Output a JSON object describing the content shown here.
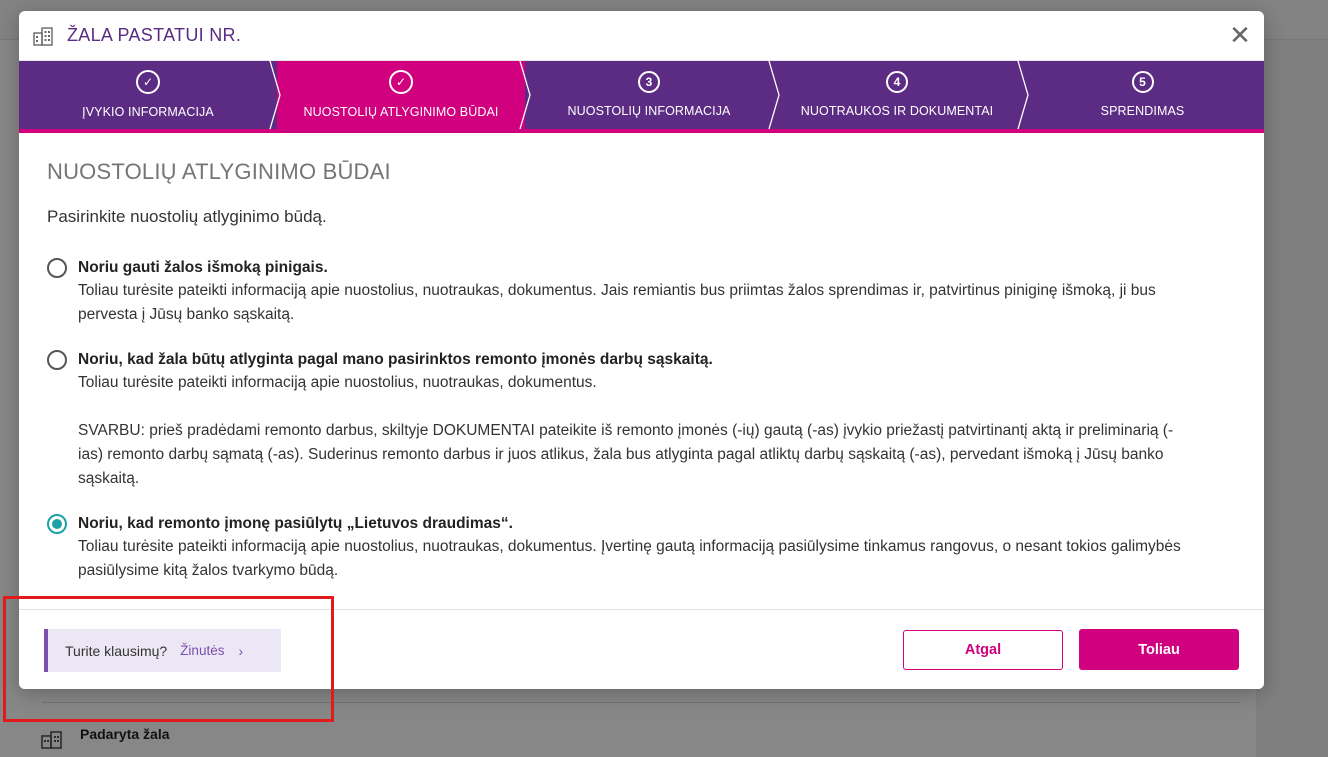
{
  "background": {
    "item_label": "Padaryta žala"
  },
  "modal": {
    "title": "ŽALA PASTATUI NR.",
    "close_glyph": "✕",
    "steps": [
      {
        "marker": "✓",
        "label": "ĮVYKIO INFORMACIJA",
        "state": "done"
      },
      {
        "marker": "✓",
        "label": "NUOSTOLIŲ ATLYGINIMO BŪDAI",
        "state": "active"
      },
      {
        "marker": "3",
        "label": "NUOSTOLIŲ INFORMACIJA",
        "state": "pending"
      },
      {
        "marker": "4",
        "label": "NUOTRAUKOS IR DOKUMENTAI",
        "state": "pending"
      },
      {
        "marker": "5",
        "label": "SPRENDIMAS",
        "state": "pending"
      }
    ],
    "section_title": "NUOSTOLIŲ ATLYGINIMO BŪDAI",
    "lead": "Pasirinkite nuostolių atlyginimo būdą.",
    "options": [
      {
        "title": "Noriu gauti žalos išmoką pinigais.",
        "text": "Toliau turėsite pateikti informaciją apie nuostolius, nuotraukas, dokumentus. Jais remiantis bus priimtas žalos sprendimas ir, patvirtinus piniginę išmoką, ji bus pervesta į Jūsų banko sąskaitą.",
        "checked": false
      },
      {
        "title": "Noriu, kad žala būtų atlyginta pagal mano pasirinktos remonto įmonės darbų sąskaitą.",
        "text": "Toliau turėsite pateikti informaciją apie nuostolius, nuotraukas, dokumentus.",
        "note": "SVARBU: prieš pradėdami remonto darbus, skiltyje DOKUMENTAI pateikite iš remonto įmonės (-ių) gautą (-as) įvykio priežastį patvirtinantį aktą ir preliminarią (-ias) remonto darbų sąmatą (-as). Suderinus remonto darbus ir juos atlikus, žala bus atlyginta pagal atliktų darbų sąskaitą (-as), pervedant išmoką į Jūsų banko sąskaitą.",
        "checked": false
      },
      {
        "title": "Noriu, kad remonto įmonę pasiūlytų „Lietuvos draudimas“.",
        "text": "Toliau turėsite pateikti informaciją apie nuostolius, nuotraukas, dokumentus. Įvertinę gautą informaciją pasiūlysime tinkamus rangovus, o nesant tokios galimybės pasiūlysime kitą žalos tvarkymo būdą.",
        "checked": true
      }
    ],
    "footer": {
      "help_question": "Turite klausimų?",
      "help_link": "Žinutės",
      "help_chevron": "›",
      "back_label": "Atgal",
      "next_label": "Toliau"
    }
  },
  "colors": {
    "primary_purple": "#5c2c84",
    "accent_magenta": "#d0007f",
    "radio_teal": "#1ba1a7",
    "highlight_red": "#e01b1b"
  }
}
